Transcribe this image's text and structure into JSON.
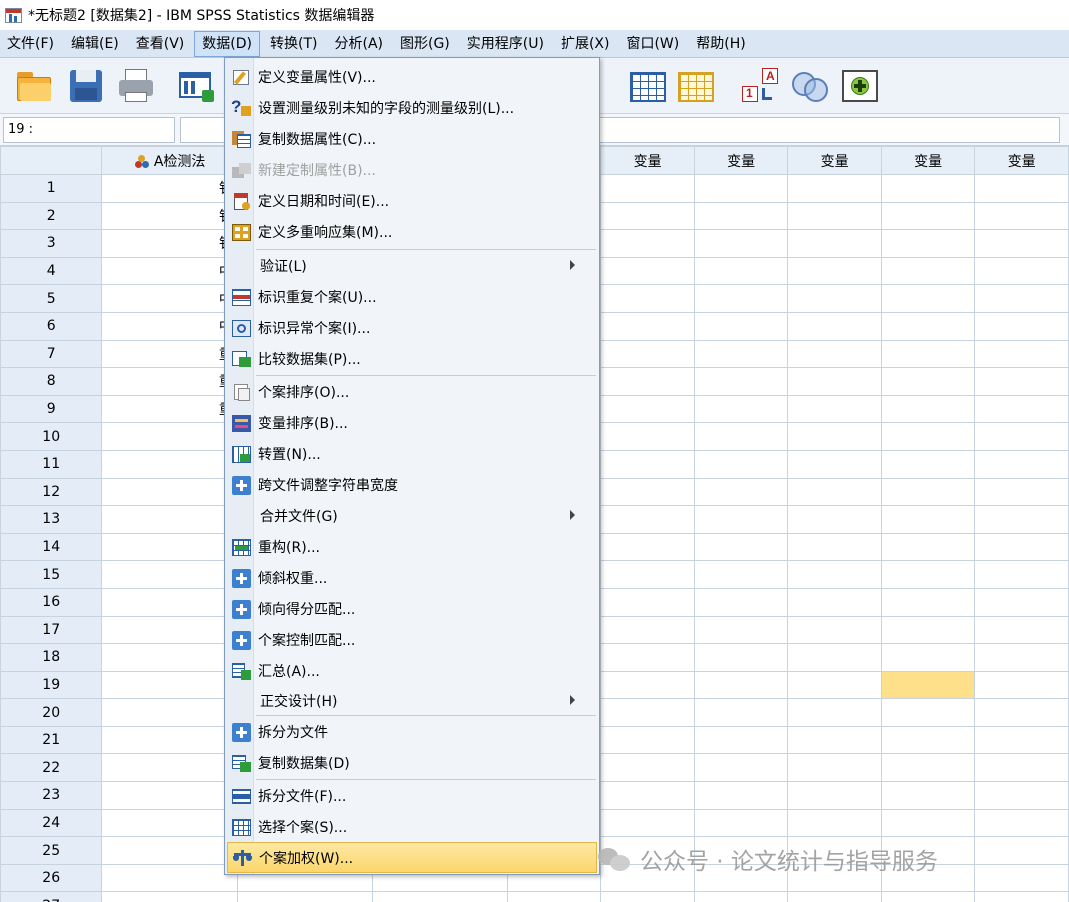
{
  "window": {
    "title": "*无标题2 [数据集2] - IBM SPSS Statistics 数据编辑器"
  },
  "menubar": {
    "items": [
      "文件(F)",
      "编辑(E)",
      "查看(V)",
      "数据(D)",
      "转换(T)",
      "分析(A)",
      "图形(G)",
      "实用程序(U)",
      "扩展(X)",
      "窗口(W)",
      "帮助(H)"
    ],
    "active_index": 3
  },
  "cellref": {
    "value": "19 :"
  },
  "grid": {
    "columns": [
      "A检测法",
      "",
      "",
      "",
      "变量",
      "变量",
      "变量",
      "变量",
      "变量"
    ],
    "rows": [
      "1",
      "2",
      "3",
      "4",
      "5",
      "6",
      "7",
      "8",
      "9",
      "10",
      "11",
      "12",
      "13",
      "14",
      "15",
      "16",
      "17",
      "18",
      "19",
      "20",
      "21",
      "22",
      "23",
      "24",
      "25",
      "26",
      "27"
    ],
    "col_a_cells": [
      "钅",
      "钅",
      "钅",
      "中",
      "中",
      "中",
      "重",
      "重",
      "重"
    ],
    "selected": {
      "row": "19",
      "column": 8
    }
  },
  "data_menu": {
    "items": [
      {
        "label": "定义变量属性(V)...",
        "icon": "define-properties-icon"
      },
      {
        "label": "设置测量级别未知的字段的测量级别(L)...",
        "icon": "measurement-level-icon"
      },
      {
        "label": "复制数据属性(C)...",
        "icon": "copy-properties-icon"
      },
      {
        "label": "新建定制属性(B)...",
        "icon": "custom-attribute-icon",
        "disabled": true
      },
      {
        "label": "定义日期和时间(E)...",
        "icon": "calendar-icon"
      },
      {
        "label": "定义多重响应集(M)...",
        "icon": "multi-response-icon"
      },
      {
        "label": "验证(L)",
        "submenu": true
      },
      {
        "label": "标识重复个案(U)...",
        "icon": "duplicate-cases-icon"
      },
      {
        "label": "标识异常个案(I)...",
        "icon": "unusual-cases-icon"
      },
      {
        "label": "比较数据集(P)...",
        "icon": "compare-datasets-icon"
      },
      {
        "label": "个案排序(O)...",
        "icon": "sort-cases-icon"
      },
      {
        "label": "变量排序(B)...",
        "icon": "sort-variables-icon"
      },
      {
        "label": "转置(N)...",
        "icon": "transpose-icon"
      },
      {
        "label": "跨文件调整字符串宽度",
        "icon": "plus-icon"
      },
      {
        "label": "合并文件(G)",
        "submenu": true
      },
      {
        "label": "重构(R)...",
        "icon": "restructure-icon"
      },
      {
        "label": "倾斜权重...",
        "icon": "plus-icon"
      },
      {
        "label": "倾向得分匹配...",
        "icon": "plus-icon"
      },
      {
        "label": "个案控制匹配...",
        "icon": "plus-icon"
      },
      {
        "label": "汇总(A)...",
        "icon": "aggregate-icon"
      },
      {
        "label": "正交设计(H)",
        "submenu": true
      },
      {
        "label": "拆分为文件",
        "icon": "plus-icon"
      },
      {
        "label": "复制数据集(D)",
        "icon": "copy-dataset-icon"
      },
      {
        "label": "拆分文件(F)...",
        "icon": "split-file-icon"
      },
      {
        "label": "选择个案(S)...",
        "icon": "select-cases-icon"
      },
      {
        "label": "个案加权(W)...",
        "icon": "weight-cases-icon",
        "highlight": true
      }
    ]
  },
  "watermark": {
    "text": "公众号 · 论文统计与指导服务"
  }
}
